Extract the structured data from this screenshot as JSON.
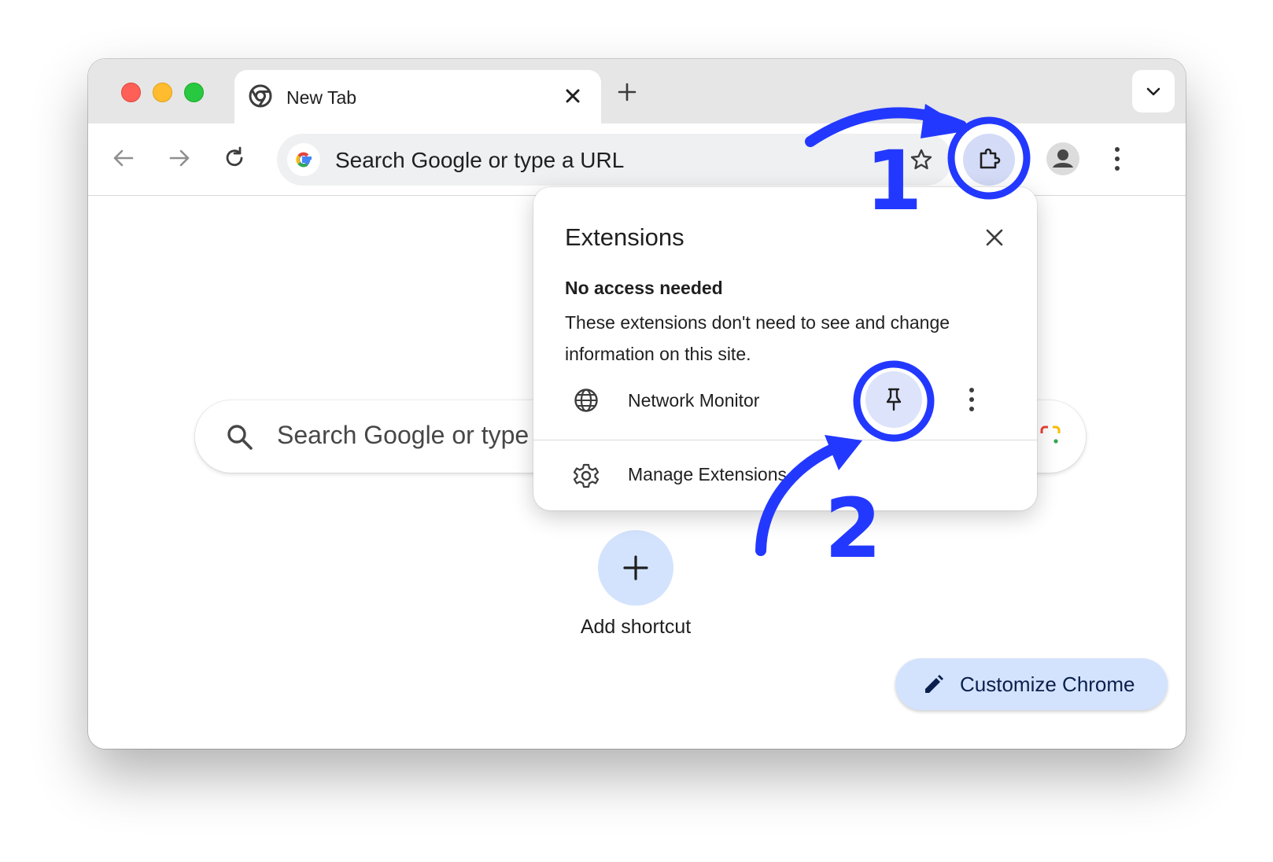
{
  "tab": {
    "title": "New Tab"
  },
  "omnibox": {
    "placeholder": "Search Google or type a URL"
  },
  "ntp": {
    "search_text": "Search Google or type",
    "add_shortcut_label": "Add shortcut",
    "customize_label": "Customize Chrome"
  },
  "extensions_popup": {
    "title": "Extensions",
    "section_heading": "No access needed",
    "section_description": "These extensions don't need to see and change information on this site.",
    "extension_name": "Network Monitor",
    "manage_label": "Manage Extensions"
  },
  "annotations": {
    "step_one": "1",
    "step_two": "2"
  },
  "colors": {
    "annotation_blue": "#2338ff",
    "extension_button_bg": "#d3dbf7",
    "customize_bg": "#d3e3fd",
    "tabstrip_bg": "#e6e6e6"
  },
  "icons": [
    "chrome-icon",
    "close-icon",
    "plus-icon",
    "chevron-down-icon",
    "back-arrow-icon",
    "forward-arrow-icon",
    "reload-icon",
    "google-g-icon",
    "star-icon",
    "puzzle-icon",
    "profile-icon",
    "kebab-menu-icon",
    "search-icon",
    "lens-icon",
    "pencil-icon",
    "globe-icon",
    "pin-icon",
    "gear-icon"
  ]
}
